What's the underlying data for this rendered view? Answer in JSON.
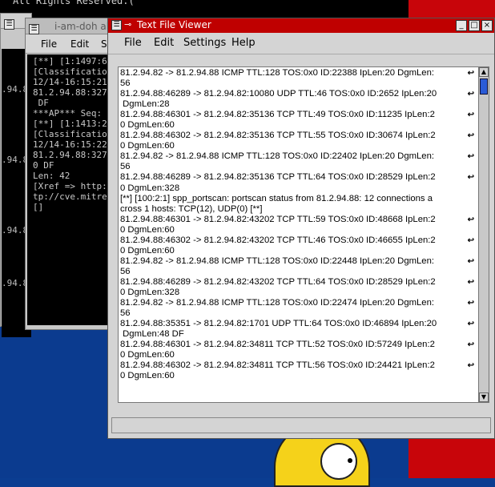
{
  "background": {
    "top_terminal_text": "All Rights Reserved.("
  },
  "back_terminal": {
    "lines": [
      "",
      "",
      ".94.8",
      "",
      "",
      "",
      ".94.8",
      "",
      "",
      "",
      ".94.8",
      "",
      "",
      ".94.8"
    ]
  },
  "middle_window": {
    "title": "i-am-doh al",
    "menu": [
      "File",
      "Edit",
      "S"
    ],
    "lines": [
      "[**] [1:1497:6",
      "[Classificatio",
      "12/14-16:15:21",
      "81.2.94.88:327",
      " DF",
      "***AP*** Seq:",
      "",
      "[**] [1:1413:2",
      "[Classificatio",
      "12/14-16:15:22",
      "81.2.94.88:327",
      "0 DF",
      "Len: 42",
      "[Xref => http:",
      "tp://cve.mitre",
      "",
      "[]"
    ]
  },
  "main_window": {
    "title": "Text File Viewer",
    "menu": {
      "file": "File",
      "edit": "Edit",
      "settings": "Settings",
      "help": "Help"
    },
    "log_lines": [
      {
        "text": "81.2.94.82 -> 81.2.94.88 ICMP TTL:128 TOS:0x0 ID:22388 IpLen:20 DgmLen:",
        "wrapped": true
      },
      {
        "text": "56",
        "wrapped": false
      },
      {
        "text": "81.2.94.88:46289 -> 81.2.94.82:10080 UDP TTL:46 TOS:0x0 ID:2652 IpLen:20",
        "wrapped": true
      },
      {
        "text": " DgmLen:28",
        "wrapped": false
      },
      {
        "text": "81.2.94.88:46301 -> 81.2.94.82:35136 TCP TTL:49 TOS:0x0 ID:11235 IpLen:2",
        "wrapped": true
      },
      {
        "text": "0 DgmLen:60",
        "wrapped": false
      },
      {
        "text": "81.2.94.88:46302 -> 81.2.94.82:35136 TCP TTL:55 TOS:0x0 ID:30674 IpLen:2",
        "wrapped": true
      },
      {
        "text": "0 DgmLen:60",
        "wrapped": false
      },
      {
        "text": "81.2.94.82 -> 81.2.94.88 ICMP TTL:128 TOS:0x0 ID:22402 IpLen:20 DgmLen:",
        "wrapped": true
      },
      {
        "text": "56",
        "wrapped": false
      },
      {
        "text": "81.2.94.88:46289 -> 81.2.94.82:35136 TCP TTL:64 TOS:0x0 ID:28529 IpLen:2",
        "wrapped": true
      },
      {
        "text": "0 DgmLen:328",
        "wrapped": false
      },
      {
        "text": "[**] [100:2:1] spp_portscan: portscan status from 81.2.94.88: 12 connections a",
        "wrapped": false
      },
      {
        "text": "cross 1 hosts: TCP(12), UDP(0) [**]",
        "wrapped": false
      },
      {
        "text": "81.2.94.88:46301 -> 81.2.94.82:43202 TCP TTL:59 TOS:0x0 ID:48668 IpLen:2",
        "wrapped": true
      },
      {
        "text": "0 DgmLen:60",
        "wrapped": false
      },
      {
        "text": "81.2.94.88:46302 -> 81.2.94.82:43202 TCP TTL:46 TOS:0x0 ID:46655 IpLen:2",
        "wrapped": true
      },
      {
        "text": "0 DgmLen:60",
        "wrapped": false
      },
      {
        "text": "81.2.94.82 -> 81.2.94.88 ICMP TTL:128 TOS:0x0 ID:22448 IpLen:20 DgmLen:",
        "wrapped": true
      },
      {
        "text": "56",
        "wrapped": false
      },
      {
        "text": "81.2.94.88:46289 -> 81.2.94.82:43202 TCP TTL:64 TOS:0x0 ID:28529 IpLen:2",
        "wrapped": true
      },
      {
        "text": "0 DgmLen:328",
        "wrapped": false
      },
      {
        "text": "81.2.94.82 -> 81.2.94.88 ICMP TTL:128 TOS:0x0 ID:22474 IpLen:20 DgmLen:",
        "wrapped": true
      },
      {
        "text": "56",
        "wrapped": false
      },
      {
        "text": "81.2.94.88:35351 -> 81.2.94.82:1701 UDP TTL:64 TOS:0x0 ID:46894 IpLen:20",
        "wrapped": true
      },
      {
        "text": " DgmLen:48 DF",
        "wrapped": false
      },
      {
        "text": "81.2.94.88:46301 -> 81.2.94.82:34811 TCP TTL:52 TOS:0x0 ID:57249 IpLen:2",
        "wrapped": true
      },
      {
        "text": "0 DgmLen:60",
        "wrapped": false
      },
      {
        "text": "81.2.94.88:46302 -> 81.2.94.82:34811 TCP TTL:56 TOS:0x0 ID:24421 IpLen:2",
        "wrapped": true
      },
      {
        "text": "0 DgmLen:60",
        "wrapped": false
      }
    ],
    "status": ""
  },
  "colors": {
    "titlebar_active": "#bf0000",
    "desktop_red": "#c8050a",
    "desktop_blue": "#0b3b8f",
    "scroll_thumb": "#2a5bd7"
  },
  "icons": {
    "wrap_marker": "line-wrap-icon",
    "window_menu": "window-menu-icon",
    "pin": "pin-icon"
  }
}
